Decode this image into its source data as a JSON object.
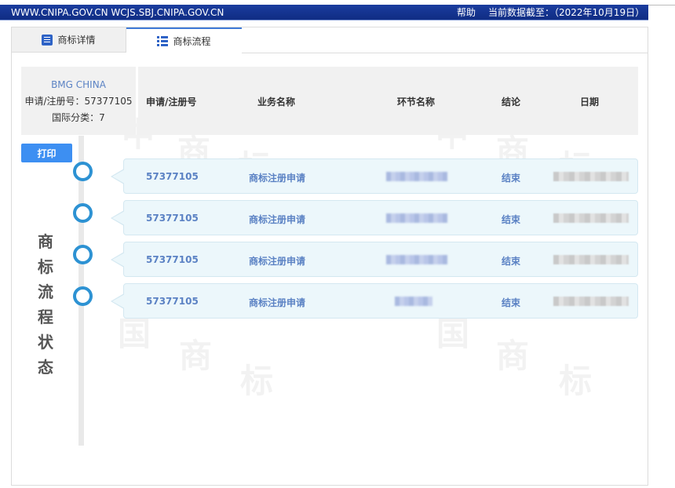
{
  "topbar": {
    "domains": "WWW.CNIPA.GOV.CN WCJS.SBJ.CNIPA.GOV.CN",
    "help": "帮助",
    "data_date": "当前数据截至：（2022年10月19日）"
  },
  "tabs": [
    {
      "label": "商标详情",
      "icon": "document-icon",
      "active": false
    },
    {
      "label": "商标流程",
      "icon": "list-icon",
      "active": true
    }
  ],
  "summary": {
    "company": "BMG CHINA",
    "reg_no": "申请/注册号：57377105",
    "intl_class": "国际分类：7"
  },
  "columns": [
    "申请/注册号",
    "业务名称",
    "环节名称",
    "结论",
    "日期"
  ],
  "print_label": "打印",
  "vertical_title": [
    "商",
    "标",
    "流",
    "程",
    "状",
    "态"
  ],
  "rows": [
    {
      "reg_no": "57377105",
      "business": "商标注册申请",
      "step": "",
      "conclusion": "结束",
      "date": ""
    },
    {
      "reg_no": "57377105",
      "business": "商标注册申请",
      "step": "",
      "conclusion": "结束",
      "date": ""
    },
    {
      "reg_no": "57377105",
      "business": "商标注册申请",
      "step": "",
      "conclusion": "结束",
      "date": ""
    },
    {
      "reg_no": "57377105",
      "business": "商标注册申请",
      "step": "",
      "conclusion": "结束",
      "date": ""
    }
  ],
  "watermark": [
    "中",
    "国",
    "商",
    "标"
  ],
  "colors": {
    "topbar": "#1b3d9f",
    "accent": "#3d8ff2",
    "link_text": "#5b82c4",
    "timeline_circle": "#2d92d3",
    "card_bg": "#ecf7fb"
  }
}
